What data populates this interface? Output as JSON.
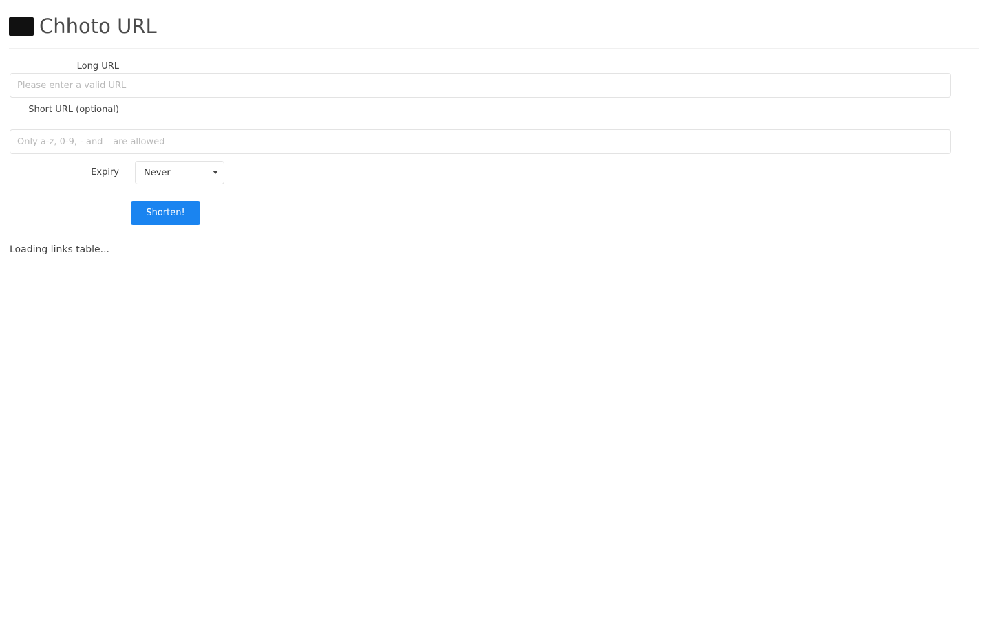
{
  "header": {
    "title": "Chhoto URL",
    "logo_icon": "terminal-icon"
  },
  "form": {
    "long_url": {
      "label": "Long URL",
      "placeholder": "Please enter a valid URL",
      "value": ""
    },
    "short_url": {
      "label": "Short URL (optional)",
      "placeholder": "Only a-z, 0-9, - and _ are allowed",
      "value": ""
    },
    "expiry": {
      "label": "Expiry",
      "selected": "Never"
    },
    "submit_label": "Shorten!"
  },
  "status": {
    "loading_text": "Loading links table..."
  },
  "colors": {
    "accent": "#1a84f0",
    "title": "#4a4a4a"
  }
}
